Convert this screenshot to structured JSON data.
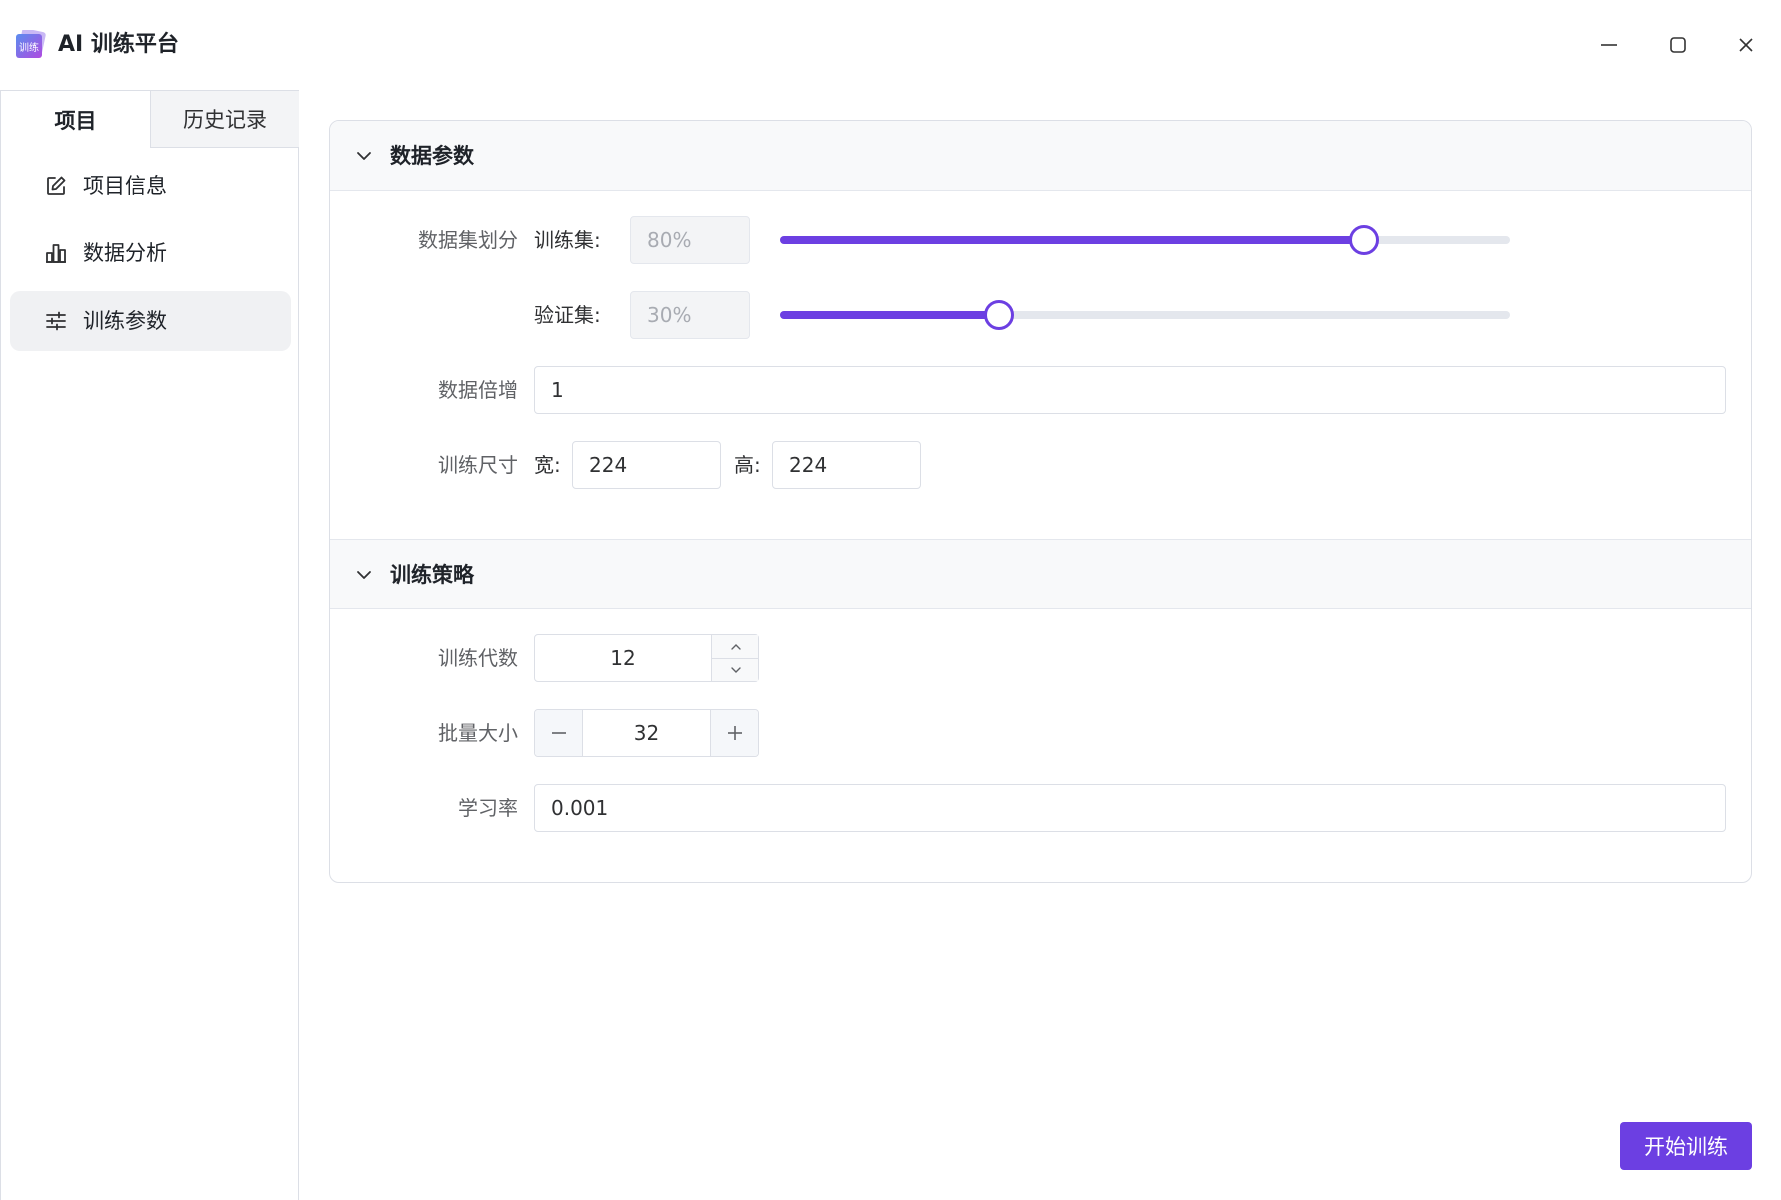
{
  "app": {
    "title": "AI 训练平台",
    "logo_text": "训练",
    "accent_color": "#6c3fe2"
  },
  "window_controls": {
    "minimize_icon": "minimize-icon",
    "maximize_icon": "maximize-icon",
    "close_icon": "close-icon"
  },
  "sidebar": {
    "tabs": [
      {
        "label": "项目",
        "active": true
      },
      {
        "label": "历史记录",
        "active": false
      }
    ],
    "items": [
      {
        "label": "项目信息",
        "icon": "edit-icon",
        "active": false
      },
      {
        "label": "数据分析",
        "icon": "bar-chart-icon",
        "active": false
      },
      {
        "label": "训练参数",
        "icon": "sliders-icon",
        "active": true
      }
    ]
  },
  "data_params": {
    "title": "数据参数",
    "split_label": "数据集划分",
    "train_label": "训练集:",
    "train_value": "80%",
    "train_percent": 80,
    "val_label": "验证集:",
    "val_value": "30%",
    "val_percent": 30,
    "augment_label": "数据倍增",
    "augment_value": "1",
    "size_label": "训练尺寸",
    "width_label": "宽:",
    "width_value": "224",
    "height_label": "高:",
    "height_value": "224"
  },
  "strategy": {
    "title": "训练策略",
    "epochs_label": "训练代数",
    "epochs_value": "12",
    "batch_label": "批量大小",
    "batch_value": "32",
    "lr_label": "学习率",
    "lr_value": "0.001"
  },
  "actions": {
    "start_label": "开始训练"
  }
}
